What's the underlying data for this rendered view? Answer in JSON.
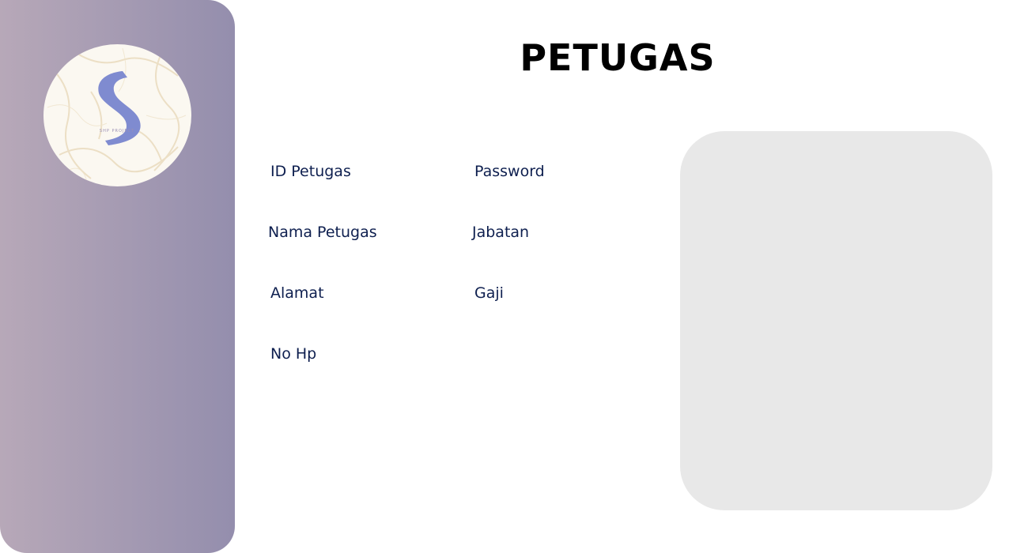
{
  "header": {
    "title": "PETUGAS"
  },
  "sidebar": {
    "logo": {
      "name": "s-logo",
      "tagline": "SHP PROJECT"
    }
  },
  "form": {
    "labels": {
      "id_petugas": "ID Petugas",
      "password": "Password",
      "nama_petugas": "Nama Petugas",
      "jabatan": "Jabatan",
      "alamat": "Alamat",
      "gaji": "Gaji",
      "no_hp": "No Hp"
    }
  },
  "colors": {
    "sidebar_gradient_start": "#b7a8b8",
    "sidebar_gradient_end": "#948ead",
    "label_text": "#0e1f4f",
    "photo_box": "#e8e8e8",
    "logo_letter": "#7f8bd0"
  }
}
